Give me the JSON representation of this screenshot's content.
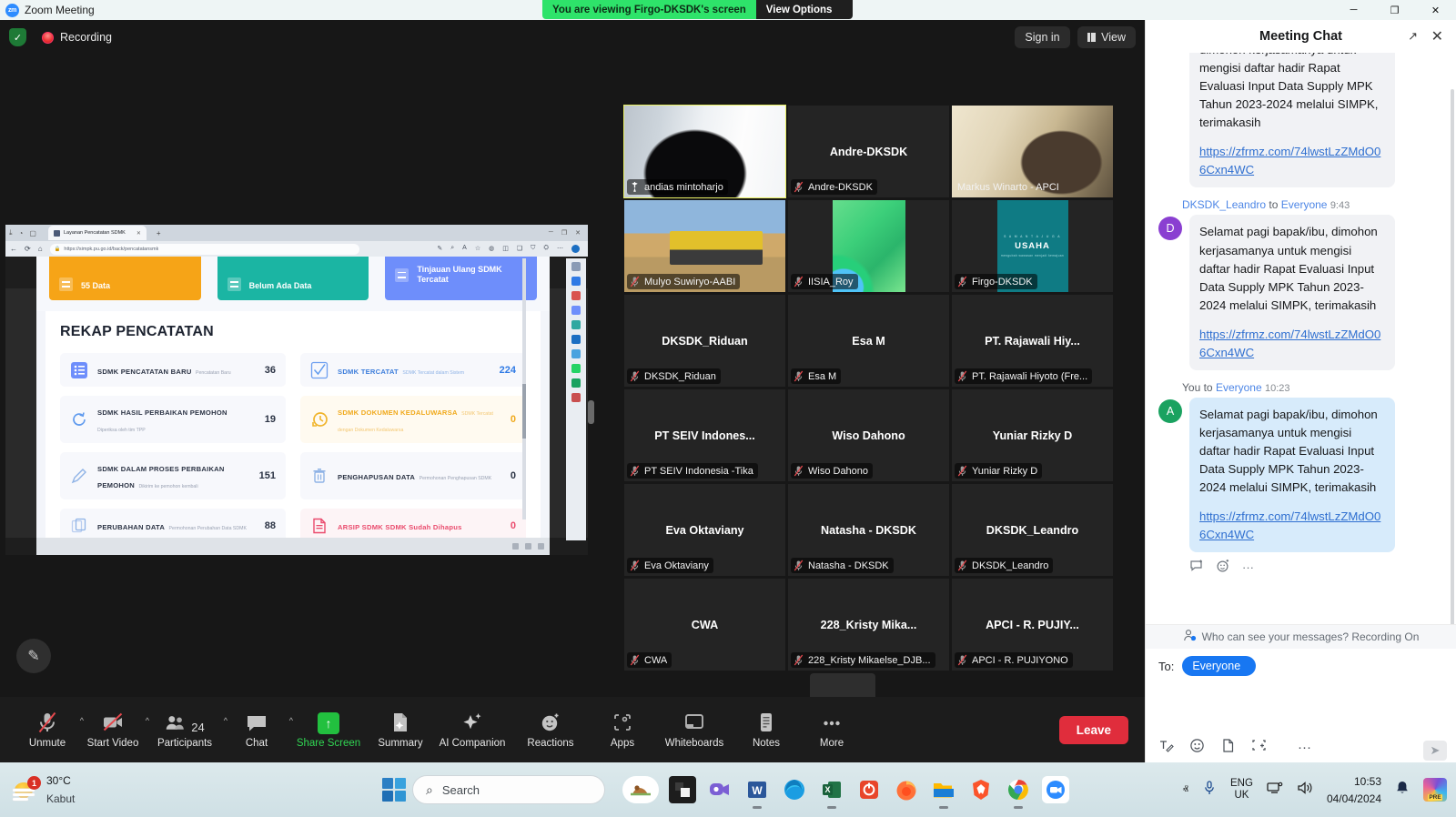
{
  "window": {
    "app_title": "Zoom Meeting",
    "logo_text": "zm",
    "minimize": "─",
    "maximize": "❐",
    "close": "✕"
  },
  "share_banner": {
    "message": "You are viewing Firgo-DKSDK's screen",
    "view_options": "View Options",
    "caret": "ⱟ"
  },
  "meeting_topbar": {
    "recording_label": "Recording",
    "sign_in": "Sign in",
    "view": "View",
    "shield_glyph": "✓"
  },
  "shared_screen": {
    "browser": {
      "tab_title": "Layanan Pencatatan SDMK",
      "tab_close": "✕",
      "new_tab": "+",
      "url": "https://simpk.pu.go.id/back/pencatatansmk",
      "lock_glyph": "ὑ2",
      "back": "←",
      "reload": "⟳",
      "home": "⌂",
      "win_min": "─",
      "win_max": "❐",
      "win_close": "✕"
    },
    "kpi_cards": [
      {
        "label": "55 Data",
        "color": "#f6a417"
      },
      {
        "label": "Belum Ada Data",
        "color": "#1bb5a3"
      },
      {
        "label": "Tinjauan Ulang SDMK Tercatat",
        "color": "#6e8efb"
      }
    ],
    "recap_title": "REKAP PENCATATAN",
    "recap_cards": [
      {
        "title": "SDMK PENCATATAN BARU",
        "subtitle": "Pencatatan Baru",
        "value": "36",
        "style": "normal"
      },
      {
        "title": "SDMK TERCATAT",
        "subtitle": "SDMK Tercatat dalam Sistem",
        "value": "224",
        "style": "blue"
      },
      {
        "title": "SDMK HASIL PERBAIKAN PEMOHON",
        "subtitle": "Diperiksa oleh tim TPP",
        "value": "19",
        "style": "normal"
      },
      {
        "title": "SDMK DOKUMEN KEDALUWARSA",
        "subtitle": "SDMK Tercatat dengan Dokumen Kedaluwarsa",
        "value": "0",
        "style": "warn"
      },
      {
        "title": "SDMK DALAM PROSES PERBAIKAN PEMOHON",
        "subtitle": "Dikirim ke pemohon kembali",
        "value": "151",
        "style": "normal"
      },
      {
        "title": "PENGHAPUSAN DATA",
        "subtitle": "Permohonan Penghapusan SDMK",
        "value": "0",
        "style": "normal"
      },
      {
        "title": "PERUBAHAN DATA",
        "subtitle": "Permohonan Perubahan Data SDMK",
        "value": "88",
        "style": "normal"
      },
      {
        "title": "ARSIP SDMK SDMK Sudah Dihapus",
        "subtitle": "",
        "value": "0",
        "style": "danger"
      }
    ]
  },
  "video_grid": {
    "tiles": [
      {
        "big_name": "",
        "badge": "andias mintoharjo",
        "state": "video",
        "icon": "pin-icon",
        "active": true,
        "thumb": "andias"
      },
      {
        "big_name": "Andre-DKSDK",
        "badge": "Andre-DKSDK",
        "state": "muted",
        "icon": "mic-off-icon",
        "active": false,
        "thumb": ""
      },
      {
        "big_name": "",
        "badge": "Markus Winarto - APCI",
        "state": "video",
        "icon": "",
        "active": false,
        "thumb": "markus"
      },
      {
        "big_name": "",
        "badge": "Mulyo Suwiryo-AABI",
        "state": "muted",
        "icon": "mic-off-icon",
        "active": false,
        "thumb": "mulyo"
      },
      {
        "big_name": "",
        "badge": "IISIA_Roy",
        "state": "muted",
        "icon": "mic-off-icon",
        "active": false,
        "thumb": "iisia"
      },
      {
        "big_name": "",
        "badge": "Firgo-DKSDK",
        "state": "muted",
        "icon": "mic-off-icon",
        "active": false,
        "thumb": "firgo"
      },
      {
        "big_name": "DKSDK_Riduan",
        "badge": "DKSDK_Riduan",
        "state": "muted",
        "icon": "mic-off-icon",
        "active": false,
        "thumb": ""
      },
      {
        "big_name": "Esa M",
        "badge": "Esa M",
        "state": "muted",
        "icon": "mic-off-icon",
        "active": false,
        "thumb": ""
      },
      {
        "big_name": "PT. Rajawali Hiy...",
        "badge": "PT. Rajawali Hiyoto (Fre...",
        "state": "muted",
        "icon": "mic-off-icon",
        "active": false,
        "thumb": ""
      },
      {
        "big_name": "PT SEIV Indones...",
        "badge": "PT SEIV Indonesia -Tika",
        "state": "muted",
        "icon": "mic-off-icon",
        "active": false,
        "thumb": ""
      },
      {
        "big_name": "Wiso Dahono",
        "badge": "Wiso Dahono",
        "state": "muted",
        "icon": "mic-off-icon",
        "active": false,
        "thumb": ""
      },
      {
        "big_name": "Yuniar Rizky D",
        "badge": "Yuniar Rizky D",
        "state": "muted",
        "icon": "mic-off-icon",
        "active": false,
        "thumb": ""
      },
      {
        "big_name": "Eva Oktaviany",
        "badge": "Eva Oktaviany",
        "state": "muted",
        "icon": "mic-off-icon",
        "active": false,
        "thumb": ""
      },
      {
        "big_name": "Natasha - DKSDK",
        "badge": "Natasha - DKSDK",
        "state": "muted",
        "icon": "mic-off-icon",
        "active": false,
        "thumb": ""
      },
      {
        "big_name": "DKSDK_Leandro",
        "badge": "DKSDK_Leandro",
        "state": "muted",
        "icon": "mic-off-icon",
        "active": false,
        "thumb": ""
      },
      {
        "big_name": "CWA",
        "badge": "CWA",
        "state": "muted",
        "icon": "mic-off-icon",
        "active": false,
        "thumb": ""
      },
      {
        "big_name": "228_Kristy  Mika...",
        "badge": "228_Kristy Mikaelse_DJB...",
        "state": "muted",
        "icon": "mic-off-icon",
        "active": false,
        "thumb": ""
      },
      {
        "big_name": "APCI - R. PUJIY...",
        "badge": "APCI - R. PUJIYONO",
        "state": "muted",
        "icon": "mic-off-icon",
        "active": false,
        "thumb": ""
      }
    ],
    "firgo_card": {
      "line1": "S A M A N T A   J U G A",
      "line2": "USAHA",
      "line3": "mengubah wawasan menjadi kemajuan"
    },
    "next_page_caret": "ⱟ"
  },
  "controls": [
    {
      "label": "Unmute",
      "icon": "mic-off-icon",
      "caret": true
    },
    {
      "label": "Start Video",
      "icon": "video-off-icon",
      "caret": true
    },
    {
      "label": "Participants",
      "icon": "participants-icon",
      "caret": true,
      "count": "24"
    },
    {
      "label": "Chat",
      "icon": "chat-icon",
      "caret": true
    },
    {
      "label": "Share Screen",
      "icon": "share-screen-icon",
      "caret": false
    },
    {
      "label": "Summary",
      "icon": "summary-icon",
      "caret": false
    },
    {
      "label": "AI Companion",
      "icon": "ai-companion-icon",
      "caret": false
    },
    {
      "label": "Reactions",
      "icon": "reactions-icon",
      "caret": false
    },
    {
      "label": "Apps",
      "icon": "apps-icon",
      "caret": false
    },
    {
      "label": "Whiteboards",
      "icon": "whiteboards-icon",
      "caret": false
    },
    {
      "label": "Notes",
      "icon": "notes-icon",
      "caret": false
    },
    {
      "label": "More",
      "icon": "more-icon",
      "caret": false
    }
  ],
  "leave_button": "Leave",
  "chat": {
    "title": "Meeting Chat",
    "popout_icon": "↗",
    "close_icon": "✕",
    "messages": [
      {
        "meta": "",
        "sender": "",
        "recipient": "",
        "time": "",
        "avatar": "",
        "avatar_color": "",
        "bubble": "grey",
        "text": "dimohon kerjasamanya untuk mengisi daftar hadir Rapat Evaluasi Input Data Supply MPK Tahun 2023-2024 melalui SIMPK, terimakasih",
        "link": "https://zfrmz.com/74lwstLzZMdO06Cxn4WC",
        "clipped": true
      },
      {
        "sender": "DKSDK_Leandro",
        "to_word": "to",
        "recipient": "Everyone",
        "time": "9:43",
        "avatar": "D",
        "avatar_color": "purple",
        "bubble": "grey",
        "text": "Selamat pagi bapak/ibu, dimohon kerjasamanya untuk mengisi daftar hadir Rapat Evaluasi Input Data Supply MPK Tahun 2023-2024 melalui SIMPK, terimakasih",
        "link": "https://zfrmz.com/74lwstLzZMdO06Cxn4WC",
        "clipped": false
      },
      {
        "sender": "You",
        "to_word": "to",
        "recipient": "Everyone",
        "time": "10:23",
        "avatar": "A",
        "avatar_color": "green",
        "bubble": "blue",
        "text": "Selamat pagi bapak/ibu, dimohon kerjasamanya untuk mengisi daftar hadir Rapat Evaluasi Input Data Supply MPK Tahun 2023-2024 melalui SIMPK, terimakasih",
        "link": "https://zfrmz.com/74lwstLzZMdO06Cxn4WC",
        "clipped": false
      }
    ],
    "message_actions": {
      "reply": "reply-icon",
      "react": "emoji-react-icon",
      "more": "···"
    },
    "privacy_notice": "Who can see your messages? Recording On",
    "to_label": "To:",
    "to_value": "Everyone",
    "to_caret": "ⱟ",
    "input_value": "",
    "input_placeholder": "",
    "tools": {
      "format": "format-text-icon",
      "emoji": "emoji-icon",
      "file": "file-icon",
      "screenshot": "screenshot-icon",
      "caret": "ⱟ",
      "more": "···",
      "send": "➤"
    }
  },
  "taskbar": {
    "weather_temp": "30°C",
    "weather_desc": "Kabut",
    "notification_count": "1",
    "search_placeholder": "Search",
    "search_icon": "search-icon",
    "start_icon": "windows-start-icon",
    "apps": [
      {
        "name": "widget-animal-icon",
        "color": "#ffffff"
      },
      {
        "name": "copilot-dark-icon",
        "color": "#1d1d1d"
      },
      {
        "name": "teams-icon",
        "color": "#7b83eb"
      },
      {
        "name": "word-icon",
        "color": "#2b579a"
      },
      {
        "name": "edge-icon",
        "color": "#1b9de2"
      },
      {
        "name": "excel-icon",
        "color": "#217346"
      },
      {
        "name": "one-icon",
        "color": "#e8452a"
      },
      {
        "name": "firefox-icon",
        "color": "#ff7139"
      },
      {
        "name": "file-explorer-icon",
        "color": "#ffb900"
      },
      {
        "name": "brave-icon",
        "color": "#fb542b"
      },
      {
        "name": "chrome-icon",
        "color": "#4285f4"
      },
      {
        "name": "zoom-icon",
        "color": "#2d8cff"
      }
    ],
    "tray": {
      "chevron": "ⱏ",
      "mic_icon": "mic-icon",
      "lang_top": "ENG",
      "lang_bottom": "UK",
      "network_icon": "network-icon",
      "volume_icon": "volume-icon",
      "time": "10:53",
      "date": "04/04/2024",
      "bell_icon": "bell-icon",
      "copilot_icon": "copilot-icon",
      "copilot_badge": "PRE"
    }
  }
}
